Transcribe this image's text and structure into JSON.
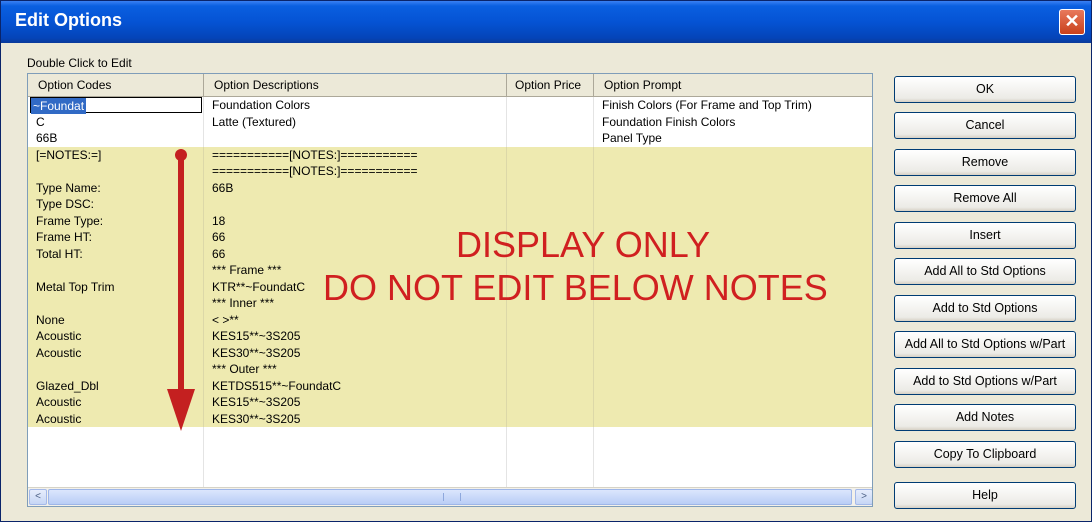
{
  "window": {
    "title": "Edit Options",
    "close_symbol": "✕"
  },
  "hint": "Double Click to Edit",
  "columns": [
    "Option Codes",
    "Option Descriptions",
    "Option Price",
    "Option Prompt"
  ],
  "edit_value": "~Foundat",
  "rows": [
    {
      "code": "~Foundat",
      "desc": "Foundation Colors",
      "price": "",
      "prompt": "Finish Colors (For Frame and Top Trim)",
      "style": "w"
    },
    {
      "code": "C",
      "desc": "Latte (Textured)",
      "price": "",
      "prompt": "Foundation Finish Colors",
      "style": "w"
    },
    {
      "code": "66B",
      "desc": "",
      "price": "",
      "prompt": "Panel Type",
      "style": "w"
    },
    {
      "code": "[=NOTES:=]",
      "desc": "===========[NOTES:]===========",
      "price": "",
      "prompt": "",
      "style": "y"
    },
    {
      "code": "",
      "desc": "===========[NOTES:]===========",
      "price": "",
      "prompt": "",
      "style": "y"
    },
    {
      "code": "Type Name:",
      "desc": "66B",
      "price": "",
      "prompt": "",
      "style": "y"
    },
    {
      "code": "Type DSC:",
      "desc": "",
      "price": "",
      "prompt": "",
      "style": "y"
    },
    {
      "code": "Frame Type:",
      "desc": "18",
      "price": "",
      "prompt": "",
      "style": "y"
    },
    {
      "code": "Frame HT:",
      "desc": "66",
      "price": "",
      "prompt": "",
      "style": "y"
    },
    {
      "code": "Total HT:",
      "desc": "66",
      "price": "",
      "prompt": "",
      "style": "y"
    },
    {
      "code": "",
      "desc": "*** Frame ***",
      "price": "",
      "prompt": "",
      "style": "y"
    },
    {
      "code": "Metal Top Trim",
      "desc": "KTR**~FoundatC",
      "price": "",
      "prompt": "",
      "style": "y"
    },
    {
      "code": "",
      "desc": "*** Inner ***",
      "price": "",
      "prompt": "",
      "style": "y"
    },
    {
      "code": "None",
      "desc": "< >**",
      "price": "",
      "prompt": "",
      "style": "y"
    },
    {
      "code": "Acoustic",
      "desc": "KES15**~3S205",
      "price": "",
      "prompt": "",
      "style": "y"
    },
    {
      "code": "Acoustic",
      "desc": "KES30**~3S205",
      "price": "",
      "prompt": "",
      "style": "y"
    },
    {
      "code": "",
      "desc": "*** Outer ***",
      "price": "",
      "prompt": "",
      "style": "y"
    },
    {
      "code": "Glazed_Dbl",
      "desc": "KETDS515**~FoundatC",
      "price": "",
      "prompt": "",
      "style": "y"
    },
    {
      "code": "Acoustic",
      "desc": "KES15**~3S205",
      "price": "",
      "prompt": "",
      "style": "y"
    },
    {
      "code": "Acoustic",
      "desc": "KES30**~3S205",
      "price": "",
      "prompt": "",
      "style": "y"
    },
    {
      "code": "",
      "desc": "",
      "price": "",
      "prompt": "",
      "style": "w"
    },
    {
      "code": "",
      "desc": "",
      "price": "",
      "prompt": "",
      "style": "w"
    },
    {
      "code": "",
      "desc": "",
      "price": "",
      "prompt": "",
      "style": "w"
    },
    {
      "code": "",
      "desc": "",
      "price": "",
      "prompt": "",
      "style": "w"
    }
  ],
  "overlay": {
    "line1": "DISPLAY ONLY",
    "line2": "DO NOT EDIT BELOW NOTES",
    "color": "#d02020"
  },
  "buttons": {
    "ok": "OK",
    "cancel": "Cancel",
    "remove": "Remove",
    "remove_all": "Remove All",
    "insert": "Insert",
    "add_all_std": "Add All to Std Options",
    "add_std": "Add to Std Options",
    "add_all_std_part": "Add All to Std Options w/Part",
    "add_std_part": "Add to Std Options w/Part",
    "add_notes": "Add Notes",
    "copy_clipboard": "Copy To Clipboard",
    "help": "Help"
  },
  "scrollbar": {
    "left_arrow": "<",
    "right_arrow": ">"
  }
}
